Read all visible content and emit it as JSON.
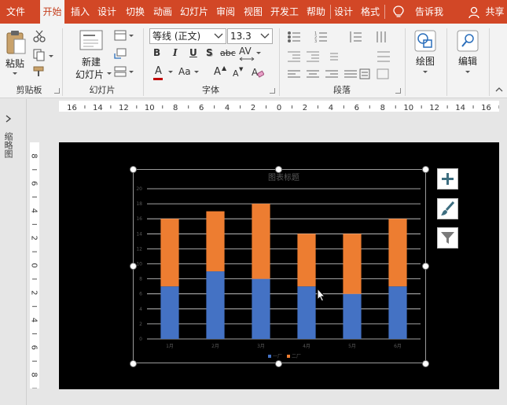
{
  "menu": {
    "tabs": [
      "文件",
      "开始",
      "插入",
      "设计",
      "切换",
      "动画",
      "幻灯片",
      "审阅",
      "视图",
      "开发工",
      "帮助",
      "设计",
      "格式"
    ],
    "active_tab": "开始",
    "tell_me": "告诉我",
    "share": "共享"
  },
  "ribbon": {
    "clipboard": {
      "paste": "粘贴",
      "group": "剪贴板"
    },
    "slides": {
      "new_slide_line1": "新建",
      "new_slide_line2": "幻灯片",
      "group": "幻灯片"
    },
    "font": {
      "font_name": "等线 (正文)",
      "font_size": "13.3",
      "bold": "B",
      "italic": "I",
      "underline": "U",
      "shadow": "S",
      "strike": "abc",
      "spacing": "AV",
      "font_color": "A",
      "change_case": "Aa",
      "grow": "A",
      "shrink": "A",
      "group": "字体"
    },
    "paragraph": {
      "group": "段落"
    },
    "drawing": {
      "label": "绘图"
    },
    "editing": {
      "label": "编辑"
    }
  },
  "thumbnail_pane": {
    "label": "缩略图"
  },
  "ruler": {
    "horizontal_labels": [
      "16",
      "14",
      "12",
      "10",
      "8",
      "6",
      "4",
      "2",
      "0",
      "2",
      "4",
      "6",
      "8",
      "10",
      "12",
      "14",
      "16"
    ],
    "vertical_labels": [
      "8",
      "6",
      "4",
      "2",
      "0",
      "2",
      "4",
      "6",
      "8"
    ]
  },
  "colors": {
    "accent": "#d24726",
    "series1": "#4472c4",
    "series2": "#ed7d31"
  },
  "chart_data": {
    "type": "bar",
    "stacked": true,
    "title": "图表标题",
    "categories": [
      "1月",
      "2月",
      "3月",
      "4月",
      "5月",
      "6月"
    ],
    "series": [
      {
        "name": "一厂",
        "values": [
          7,
          9,
          8,
          7,
          6,
          7
        ]
      },
      {
        "name": "二厂",
        "values": [
          9,
          8,
          10,
          7,
          8,
          9
        ]
      }
    ],
    "ylim": [
      0,
      20
    ],
    "yticks": [
      0,
      2,
      4,
      6,
      8,
      10,
      12,
      14,
      16,
      18,
      20
    ],
    "grid": true,
    "legend": "bottom"
  }
}
